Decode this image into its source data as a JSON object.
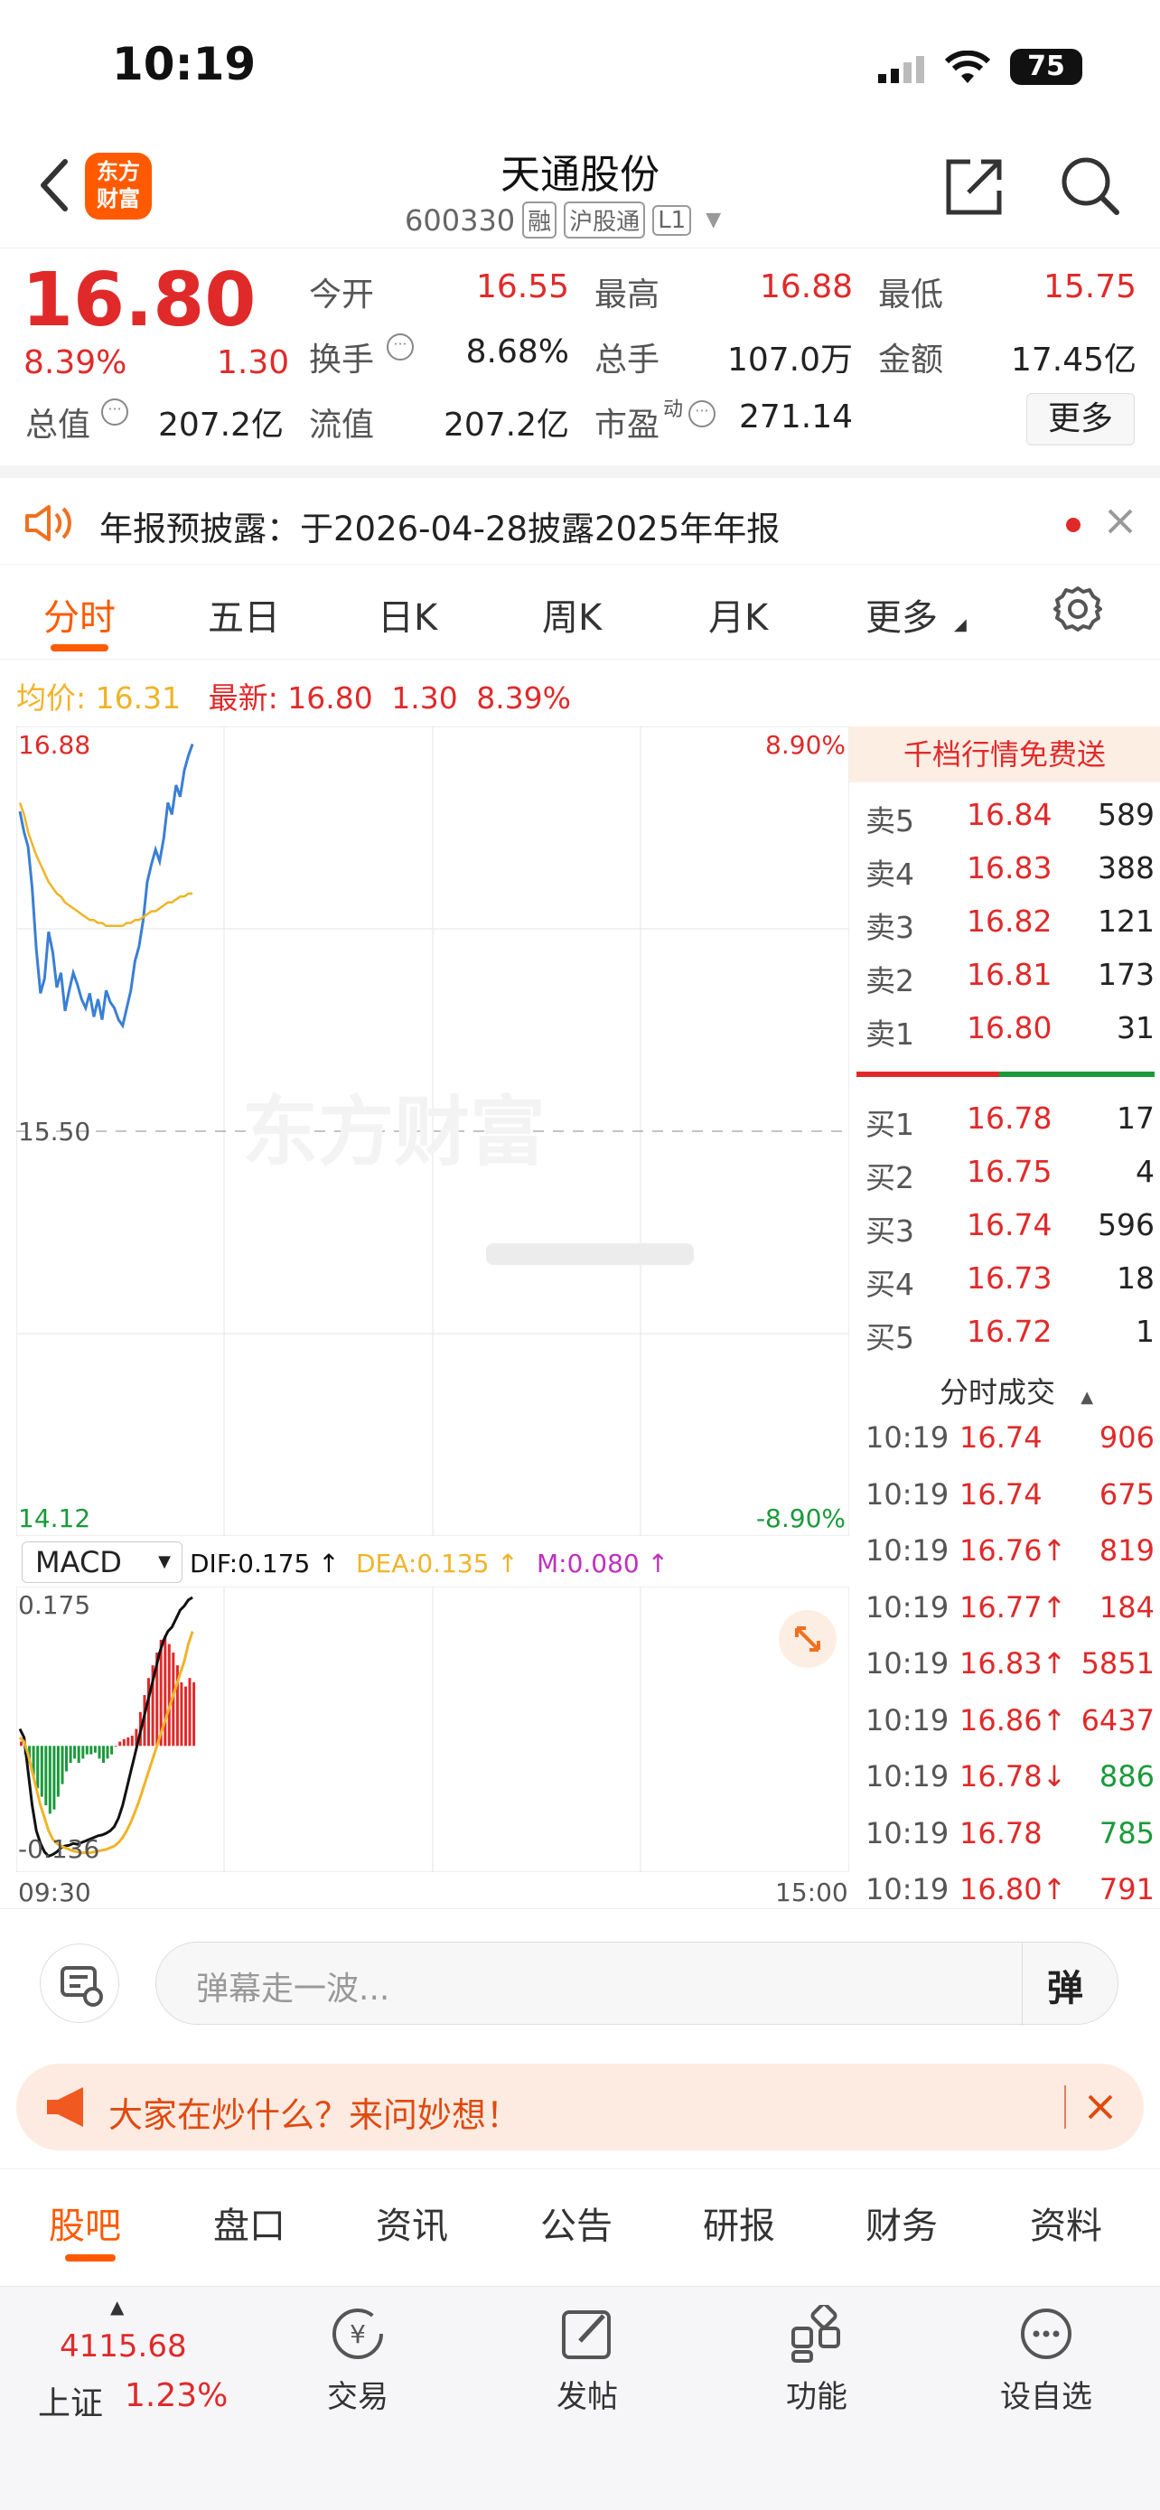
{
  "status": {
    "time": "10:19",
    "battery": "75"
  },
  "header": {
    "logo_text": "东方财富",
    "title": "天通股份",
    "code": "600330",
    "tags": [
      "融",
      "沪股通",
      "L1"
    ]
  },
  "quote": {
    "price": "16.80",
    "change_pct": "8.39%",
    "change": "1.30",
    "stats": [
      {
        "label": "今开",
        "value": "16.55",
        "color": "red"
      },
      {
        "label": "最高",
        "value": "16.88",
        "color": "red"
      },
      {
        "label": "最低",
        "value": "15.75",
        "color": "red"
      },
      {
        "label": "换手",
        "value": "8.68%",
        "color": "dark"
      },
      {
        "label": "总手",
        "value": "107.0万",
        "color": "dark"
      },
      {
        "label": "金额",
        "value": "17.45亿",
        "color": "dark"
      },
      {
        "label": "总值",
        "value": "207.2亿",
        "color": "dark"
      },
      {
        "label": "流值",
        "value": "207.2亿",
        "color": "dark"
      },
      {
        "label": "市盈",
        "value": "271.14",
        "color": "dark"
      }
    ],
    "pe_superscript": "动",
    "more_label": "更多"
  },
  "notice": {
    "text": "年报预披露：于2026-04-28披露2025年年报"
  },
  "tabs": [
    "分时",
    "五日",
    "日K",
    "周K",
    "月K",
    "更多"
  ],
  "active_tab": 0,
  "price_line": {
    "avg_label": "均价:",
    "avg_value": "16.31",
    "latest_label": "最新:",
    "latest_value": "16.80",
    "latest_change": "1.30",
    "latest_pct": "8.39%"
  },
  "chart_data": {
    "type": "line",
    "y_top": "16.88",
    "y_mid": "15.50",
    "y_bottom": "14.12",
    "pct_top": "8.90%",
    "pct_bottom": "-8.90%",
    "watermark": "东方财富",
    "x_start": "09:30",
    "x_end": "15:00",
    "ylim": [
      14.12,
      16.88
    ],
    "series": [
      {
        "name": "price",
        "color": "#3a7fd5",
        "values": [
          16.59,
          16.52,
          16.47,
          16.33,
          16.12,
          15.97,
          16.02,
          16.18,
          16.11,
          15.99,
          16.04,
          15.91,
          15.98,
          16.04,
          16.0,
          15.95,
          15.92,
          15.97,
          15.89,
          15.95,
          15.88,
          15.98,
          15.94,
          15.92,
          15.88,
          15.86,
          15.92,
          15.98,
          16.08,
          16.13,
          16.22,
          16.35,
          16.41,
          16.46,
          16.42,
          16.5,
          16.62,
          16.58,
          16.68,
          16.64,
          16.73,
          16.78,
          16.82
        ]
      },
      {
        "name": "average",
        "color": "#f0b429",
        "values": [
          16.62,
          16.58,
          16.52,
          16.48,
          16.44,
          16.41,
          16.38,
          16.35,
          16.33,
          16.31,
          16.3,
          16.28,
          16.27,
          16.26,
          16.25,
          16.24,
          16.23,
          16.22,
          16.22,
          16.21,
          16.21,
          16.2,
          16.2,
          16.2,
          16.2,
          16.2,
          16.21,
          16.21,
          16.22,
          16.22,
          16.23,
          16.24,
          16.25,
          16.25,
          16.26,
          16.27,
          16.28,
          16.28,
          16.29,
          16.3,
          16.3,
          16.31,
          16.31
        ]
      }
    ]
  },
  "macd": {
    "label": "MACD",
    "dif": "DIF:0.175 ↑",
    "dea": "DEA:0.135 ↑",
    "m": "M:0.080 ↑",
    "top": "0.175",
    "bottom": "-0.136",
    "ylim": [
      -0.136,
      0.175
    ],
    "bars": [
      0.005,
      -0.01,
      -0.02,
      -0.035,
      -0.05,
      -0.06,
      -0.07,
      -0.08,
      -0.075,
      -0.06,
      -0.045,
      -0.03,
      -0.02,
      -0.015,
      -0.02,
      -0.015,
      -0.01,
      -0.01,
      -0.008,
      -0.015,
      -0.02,
      -0.015,
      -0.01,
      0,
      0.005,
      0.008,
      0.01,
      0.012,
      0.02,
      0.04,
      0.06,
      0.08,
      0.095,
      0.11,
      0.125,
      0.13,
      0.12,
      0.11,
      0.095,
      0.075,
      0.07,
      0.08,
      0.075
    ],
    "dif_values": [
      0.02,
      0.01,
      -0.03,
      -0.07,
      -0.1,
      -0.115,
      -0.125,
      -0.13,
      -0.128,
      -0.125,
      -0.12,
      -0.118,
      -0.117,
      -0.115,
      -0.116,
      -0.114,
      -0.112,
      -0.11,
      -0.108,
      -0.106,
      -0.105,
      -0.103,
      -0.1,
      -0.095,
      -0.085,
      -0.07,
      -0.05,
      -0.03,
      -0.01,
      0.01,
      0.03,
      0.05,
      0.07,
      0.09,
      0.11,
      0.125,
      0.135,
      0.14,
      0.15,
      0.16,
      0.165,
      0.172,
      0.175
    ],
    "dea_values": [
      0.01,
      0.005,
      -0.01,
      -0.03,
      -0.05,
      -0.07,
      -0.085,
      -0.1,
      -0.11,
      -0.115,
      -0.118,
      -0.12,
      -0.122,
      -0.124,
      -0.125,
      -0.126,
      -0.126,
      -0.126,
      -0.125,
      -0.124,
      -0.123,
      -0.122,
      -0.12,
      -0.118,
      -0.114,
      -0.108,
      -0.1,
      -0.09,
      -0.078,
      -0.065,
      -0.05,
      -0.035,
      -0.02,
      -0.005,
      0.01,
      0.025,
      0.04,
      0.055,
      0.07,
      0.085,
      0.1,
      0.12,
      0.135
    ]
  },
  "orderbook": {
    "header": "千档行情免费送",
    "asks": [
      {
        "label": "卖5",
        "price": "16.84",
        "vol": "589"
      },
      {
        "label": "卖4",
        "price": "16.83",
        "vol": "388"
      },
      {
        "label": "卖3",
        "price": "16.82",
        "vol": "121"
      },
      {
        "label": "卖2",
        "price": "16.81",
        "vol": "173"
      },
      {
        "label": "卖1",
        "price": "16.80",
        "vol": "31"
      }
    ],
    "bids": [
      {
        "label": "买1",
        "price": "16.78",
        "vol": "17"
      },
      {
        "label": "买2",
        "price": "16.75",
        "vol": "4"
      },
      {
        "label": "买3",
        "price": "16.74",
        "vol": "596"
      },
      {
        "label": "买4",
        "price": "16.73",
        "vol": "18"
      },
      {
        "label": "买5",
        "price": "16.72",
        "vol": "1"
      }
    ],
    "trades_title": "分时成交",
    "trades": [
      {
        "time": "10:19",
        "price": "16.74",
        "vol": "906",
        "pc": "red",
        "vc": "red"
      },
      {
        "time": "10:19",
        "price": "16.74",
        "vol": "675",
        "pc": "red",
        "vc": "red"
      },
      {
        "time": "10:19",
        "price": "16.76↑",
        "vol": "819",
        "pc": "red",
        "vc": "red"
      },
      {
        "time": "10:19",
        "price": "16.77↑",
        "vol": "184",
        "pc": "red",
        "vc": "red"
      },
      {
        "time": "10:19",
        "price": "16.83↑",
        "vol": "5851",
        "pc": "red",
        "vc": "red"
      },
      {
        "time": "10:19",
        "price": "16.86↑",
        "vol": "6437",
        "pc": "red",
        "vc": "red"
      },
      {
        "time": "10:19",
        "price": "16.78↓",
        "vol": "886",
        "pc": "red",
        "vc": "green"
      },
      {
        "time": "10:19",
        "price": "16.78",
        "vol": "785",
        "pc": "red",
        "vc": "green"
      },
      {
        "time": "10:19",
        "price": "16.80↑",
        "vol": "791",
        "pc": "red",
        "vc": "red"
      }
    ]
  },
  "danmu": {
    "placeholder": "弹幕走一波...",
    "button": "弹"
  },
  "ask_banner": {
    "text": "大家在炒什么？来问妙想！"
  },
  "subtabs": [
    "股吧",
    "盘口",
    "资讯",
    "公告",
    "研报",
    "财务",
    "资料"
  ],
  "bottom": {
    "index_value": "4115.68",
    "index_name": "上证",
    "index_pct": "1.23%",
    "items": [
      "交易",
      "发帖",
      "功能",
      "设自选"
    ]
  }
}
